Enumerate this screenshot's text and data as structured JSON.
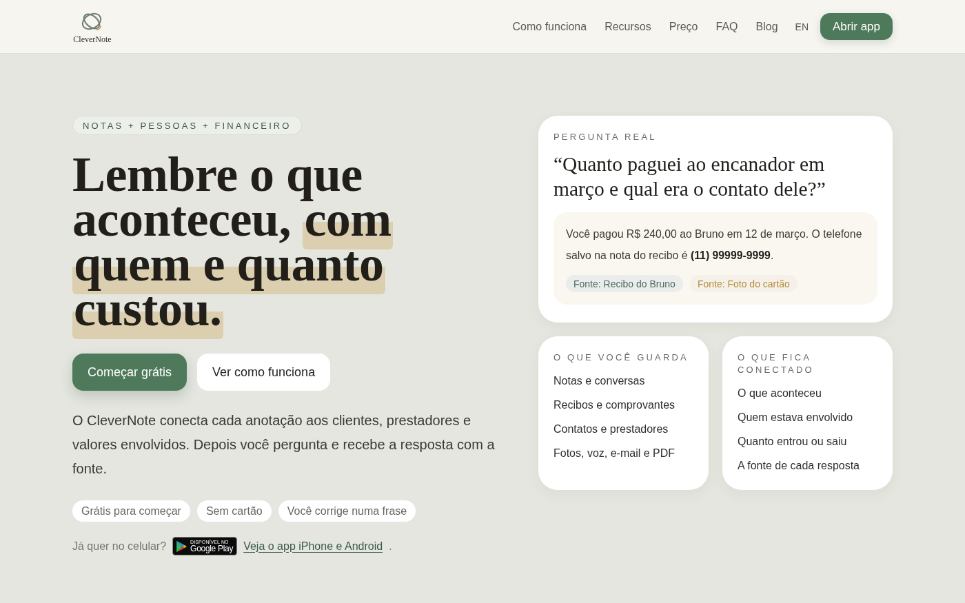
{
  "header": {
    "brand": "CleverNote",
    "nav": [
      "Como funciona",
      "Recursos",
      "Preço",
      "FAQ",
      "Blog"
    ],
    "language": "EN",
    "cta": "Abrir app"
  },
  "hero": {
    "eyebrow": "NOTAS + PESSOAS + FINANCEIRO",
    "headline": [
      {
        "text": "Lembre o que aconteceu, ",
        "highlighted": false
      },
      {
        "text": "com quem e quanto custou.",
        "highlighted": true
      }
    ],
    "buttons": [
      {
        "label": "Começar grátis",
        "kind": "primary"
      },
      {
        "label": "Ver como funciona",
        "kind": "secondary"
      }
    ],
    "description": "O CleverNote conecta cada anotação aos clientes, prestadores e valores envolvidos. Depois você pergunta e recebe a resposta com a fonte.",
    "perks": [
      "Grátis para começar",
      "Sem cartão",
      "Você corrige numa frase"
    ],
    "mobile": {
      "prompt": "Já quer no celular?",
      "store_badge": {
        "top": "DISPONÍVEL NO",
        "bottom": "Google Play"
      },
      "link": "Veja o app iPhone e Android",
      "suffix": "."
    }
  },
  "question_card": {
    "label": "PERGUNTA REAL",
    "question": "“Quanto paguei ao encanador em março e qual era o contato dele?”",
    "answer": "Você pagou R$ 240,00 ao Bruno em 12 de março. O telefone salvo na nota do recibo é **(11) 99999-9999**.",
    "sources": [
      {
        "label": "Fonte: Recibo do Bruno",
        "color": "#4f6b5c"
      },
      {
        "label": "Fonte: Foto do cartão",
        "color": "#b58b3e"
      }
    ]
  },
  "feature_cards": [
    {
      "title": "O QUE VOCÊ GUARDA",
      "items": [
        "Notas e conversas",
        "Recibos e comprovantes",
        "Contatos e prestadores",
        "Fotos, voz, e-mail e PDF"
      ]
    },
    {
      "title": "O QUE FICA CONECTADO",
      "items": [
        "O que aconteceu",
        "Quem estava envolvido",
        "Quanto entrou ou saiu",
        "A fonte de cada resposta"
      ]
    }
  ]
}
